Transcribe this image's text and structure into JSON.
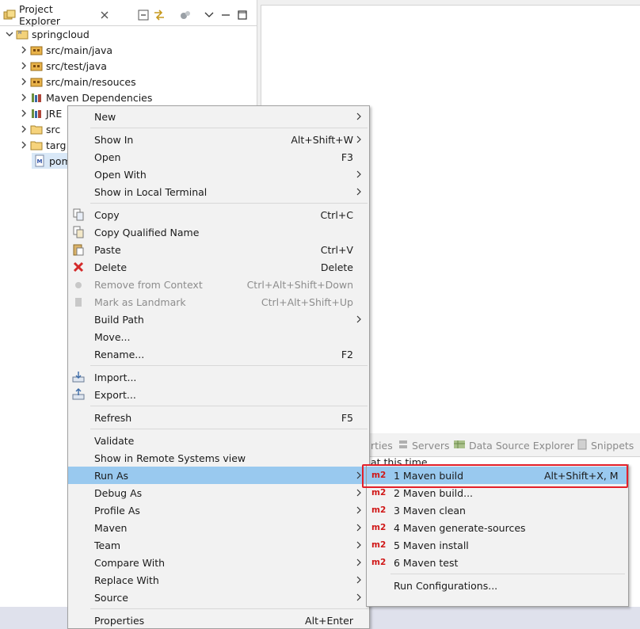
{
  "explorer": {
    "tab_title": "Project Explorer",
    "tree": [
      {
        "label": "springcloud",
        "icon": "project-icon"
      },
      {
        "label": "src/main/java",
        "icon": "source-folder-icon"
      },
      {
        "label": "src/test/java",
        "icon": "source-folder-icon"
      },
      {
        "label": "src/main/resouces",
        "icon": "source-folder-icon"
      },
      {
        "label": "Maven Dependencies",
        "icon": "library-icon"
      },
      {
        "label": "JRE",
        "icon": "library-icon"
      },
      {
        "label": "src",
        "icon": "folder-icon"
      },
      {
        "label": "targ",
        "icon": "folder-icon"
      },
      {
        "label": "pom",
        "icon": "pom-file-icon"
      }
    ]
  },
  "bottom_panel": {
    "tabs": [
      "rties",
      "Servers",
      "Data Source Explorer",
      "Snippets"
    ],
    "content_text": "at this time"
  },
  "context_menu": {
    "items": [
      {
        "label": "New",
        "accel": "",
        "submenu": true
      },
      {
        "label": "Show In",
        "accel": "Alt+Shift+W",
        "submenu": true
      },
      {
        "label": "Open",
        "accel": "F3"
      },
      {
        "label": "Open With",
        "accel": "",
        "submenu": true
      },
      {
        "label": "Show in Local Terminal",
        "accel": "",
        "submenu": true
      },
      {
        "label": "Copy",
        "accel": "Ctrl+C",
        "icon": "copy-icon"
      },
      {
        "label": "Copy Qualified Name",
        "accel": "",
        "icon": "copy-qualified-name-icon"
      },
      {
        "label": "Paste",
        "accel": "Ctrl+V",
        "icon": "paste-icon"
      },
      {
        "label": "Delete",
        "accel": "Delete",
        "icon": "delete-icon"
      },
      {
        "label": "Remove from Context",
        "accel": "Ctrl+Alt+Shift+Down",
        "disabled": true,
        "icon": "remove-context-icon"
      },
      {
        "label": "Mark as Landmark",
        "accel": "Ctrl+Alt+Shift+Up",
        "disabled": true,
        "icon": "landmark-icon"
      },
      {
        "label": "Build Path",
        "accel": "",
        "submenu": true
      },
      {
        "label": "Move...",
        "accel": ""
      },
      {
        "label": "Rename...",
        "accel": "F2"
      },
      {
        "label": "Import...",
        "accel": "",
        "icon": "import-icon"
      },
      {
        "label": "Export...",
        "accel": "",
        "icon": "export-icon"
      },
      {
        "label": "Refresh",
        "accel": "F5"
      },
      {
        "label": "Validate",
        "accel": ""
      },
      {
        "label": "Show in Remote Systems view",
        "accel": ""
      },
      {
        "label": "Run As",
        "accel": "",
        "submenu": true,
        "highlighted": true
      },
      {
        "label": "Debug As",
        "accel": "",
        "submenu": true
      },
      {
        "label": "Profile As",
        "accel": "",
        "submenu": true
      },
      {
        "label": "Maven",
        "accel": "",
        "submenu": true
      },
      {
        "label": "Team",
        "accel": "",
        "submenu": true
      },
      {
        "label": "Compare With",
        "accel": "",
        "submenu": true
      },
      {
        "label": "Replace With",
        "accel": "",
        "submenu": true
      },
      {
        "label": "Source",
        "accel": "",
        "submenu": true
      },
      {
        "label": "Properties",
        "accel": "Alt+Enter"
      }
    ]
  },
  "run_as_submenu": {
    "badge": "m2",
    "items": [
      {
        "label": "1 Maven build",
        "accel": "Alt+Shift+X, M",
        "highlighted": true
      },
      {
        "label": "2 Maven build...",
        "accel": ""
      },
      {
        "label": "3 Maven clean",
        "accel": ""
      },
      {
        "label": "4 Maven generate-sources",
        "accel": ""
      },
      {
        "label": "5 Maven install",
        "accel": ""
      },
      {
        "label": "6 Maven test",
        "accel": ""
      },
      {
        "label": "Run Configurations...",
        "accel": ""
      }
    ]
  },
  "colors": {
    "highlight": "#99c9ef",
    "annotation_red": "#e3202a",
    "m2_badge": "#d01818"
  }
}
